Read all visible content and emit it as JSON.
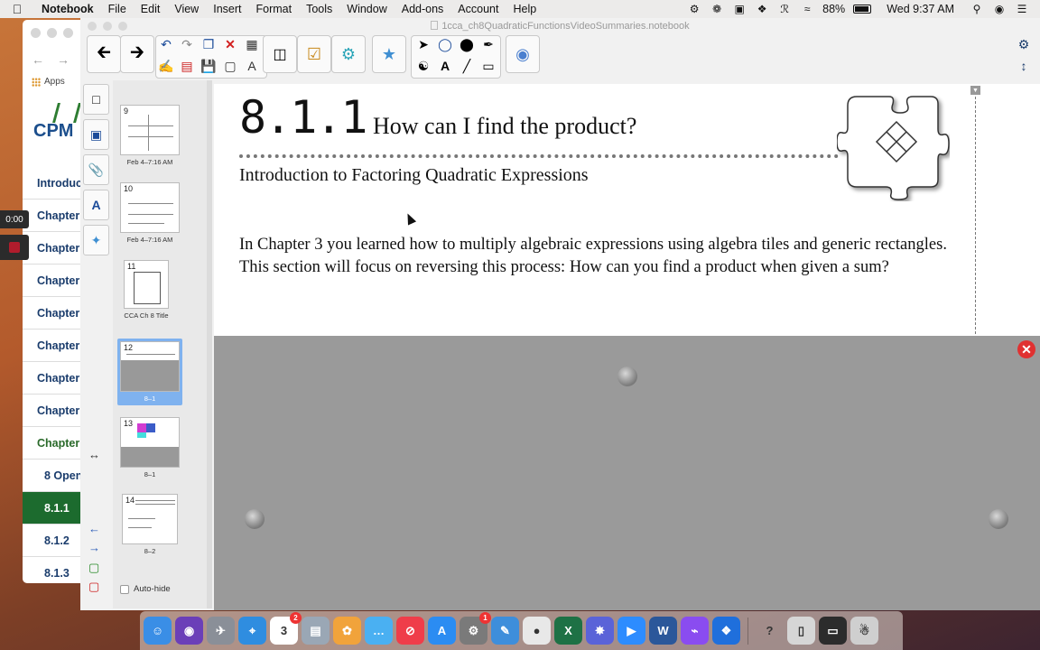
{
  "menubar": {
    "app_name": "Notebook",
    "items": [
      "File",
      "Edit",
      "View",
      "Insert",
      "Format",
      "Tools",
      "Window",
      "Add-ons",
      "Account",
      "Help"
    ],
    "battery": "88%",
    "clock": "Wed 9:37 AM"
  },
  "browser": {
    "apps_label": "Apps",
    "logo": "CPM",
    "nav": [
      {
        "label": "Introduc",
        "style": "normal"
      },
      {
        "label": "Chapter",
        "style": "normal"
      },
      {
        "label": "Chapter",
        "style": "normal"
      },
      {
        "label": "Chapter",
        "style": "normal"
      },
      {
        "label": "Chapter",
        "style": "normal"
      },
      {
        "label": "Chapter",
        "style": "normal"
      },
      {
        "label": "Chapter",
        "style": "normal"
      },
      {
        "label": "Chapter",
        "style": "normal"
      },
      {
        "label": "Chapter",
        "style": "green"
      },
      {
        "label": "8 Open",
        "style": "sub"
      },
      {
        "label": "8.1.1",
        "style": "active"
      },
      {
        "label": "8.1.2",
        "style": "sub"
      },
      {
        "label": "8.1.3",
        "style": "sub"
      }
    ]
  },
  "video": {
    "timer": "0:00"
  },
  "window": {
    "title": "1cca_ch8QuadraticFunctionsVideoSummaries.notebook"
  },
  "sorter": {
    "pages": [
      {
        "num": "9",
        "caption": "Feb 4–7:16 AM",
        "selected": false
      },
      {
        "num": "10",
        "caption": "Feb 4–7:16 AM",
        "selected": false
      },
      {
        "num": "11",
        "caption": "CCA Ch 8 Title",
        "selected": false
      },
      {
        "num": "12",
        "caption": "8–1",
        "selected": true
      },
      {
        "num": "13",
        "caption": "8–1",
        "selected": false
      },
      {
        "num": "14",
        "caption": "8–2",
        "selected": false
      }
    ],
    "auto_hide": "Auto-hide"
  },
  "page": {
    "section_number": "8.1.1",
    "question": "How can I find the product?",
    "subtitle": "Introduction to Factoring Quadratic Expressions",
    "paragraph": "In Chapter 3 you learned how to multiply algebraic expressions using algebra tiles and generic rectangles.  This section will focus on reversing this process: How can you find a product when given a sum?"
  },
  "colors": {
    "selection": "#7fb2ef",
    "nav_active": "#1c6b2e",
    "close_red": "#e03131",
    "shade": "#9a9a9a"
  },
  "dock": {
    "apps": [
      {
        "name": "Finder",
        "color": "#3a8ee6",
        "glyph": "☺"
      },
      {
        "name": "Siri",
        "color": "#6b3fb8",
        "glyph": "◉"
      },
      {
        "name": "Launchpad",
        "color": "#8a8f98",
        "glyph": "✈"
      },
      {
        "name": "Safari",
        "color": "#2f8de0",
        "glyph": "⌖"
      },
      {
        "name": "Calendar",
        "color": "#ffffff",
        "glyph": "3",
        "badge": "2"
      },
      {
        "name": "Preview",
        "color": "#9aa7b5",
        "glyph": "▤"
      },
      {
        "name": "Photos",
        "color": "#f1a33b",
        "glyph": "✿"
      },
      {
        "name": "Messages",
        "color": "#4ab0f2",
        "glyph": "…"
      },
      {
        "name": "News",
        "color": "#ef3d4a",
        "glyph": "⊘"
      },
      {
        "name": "App Store",
        "color": "#2b8cf2",
        "glyph": "A"
      },
      {
        "name": "System Preferences",
        "color": "#7a7a7a",
        "glyph": "⚙",
        "badge": "1"
      },
      {
        "name": "Notebook",
        "color": "#3e8edb",
        "glyph": "✎"
      },
      {
        "name": "Chrome",
        "color": "#e8e8e8",
        "glyph": "●"
      },
      {
        "name": "Excel",
        "color": "#1e7145",
        "glyph": "X"
      },
      {
        "name": "Ink",
        "color": "#5a63d8",
        "glyph": "✸"
      },
      {
        "name": "Zoom",
        "color": "#2d8cff",
        "glyph": "▶"
      },
      {
        "name": "Word",
        "color": "#2b579a",
        "glyph": "W"
      },
      {
        "name": "Messenger",
        "color": "#8a4cf0",
        "glyph": "⌁"
      },
      {
        "name": "Dropbox",
        "color": "#1f6fdc",
        "glyph": "❖"
      },
      {
        "name": "Help",
        "color": "transparent",
        "glyph": "?"
      },
      {
        "name": "Phone",
        "color": "#d6d6d6",
        "glyph": "▯"
      },
      {
        "name": "Screen",
        "color": "#2c2c2c",
        "glyph": "▭"
      },
      {
        "name": "Trash",
        "color": "#cfcfcf",
        "glyph": "☃"
      }
    ]
  }
}
